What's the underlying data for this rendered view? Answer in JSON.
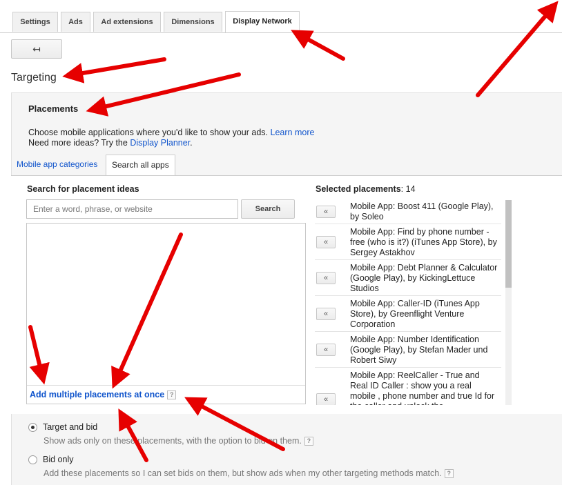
{
  "tabs": [
    {
      "label": "Settings"
    },
    {
      "label": "Ads"
    },
    {
      "label": "Ad extensions"
    },
    {
      "label": "Dimensions"
    },
    {
      "label": "Display Network",
      "active": true
    }
  ],
  "back_button": {
    "icon": "back-arrow-icon",
    "glyph": "↤"
  },
  "page_title": "Targeting",
  "placements": {
    "title": "Placements",
    "desc_line1": "Choose mobile applications where you'd like to show your ads.",
    "learn_more": "Learn more",
    "desc_line2_prefix": "Need more ideas? Try the",
    "display_planner": "Display Planner",
    "desc_line2_suffix": "."
  },
  "subtabs": {
    "categories": "Mobile app categories",
    "search_all": "Search all apps"
  },
  "search": {
    "label": "Search for placement ideas",
    "placeholder": "Enter a word, phrase, or website",
    "button": "Search",
    "add_multiple": "Add multiple placements at once",
    "help": "?"
  },
  "selected": {
    "label": "Selected placements",
    "count": "14",
    "remove_glyph": "«",
    "items": [
      "Mobile App: Boost 411 (Google Play), by Soleo",
      "Mobile App: Find by phone number - free (who is it?) (iTunes App Store), by Sergey Astakhov",
      "Mobile App: Debt Planner & Calculator (Google Play), by KickingLettuce Studios",
      "Mobile App: Caller-ID (iTunes App Store), by Greenflight Venture Corporation",
      "Mobile App: Number Identification (Google Play), by Stefan Mader und Robert Siwy",
      "Mobile App: ReelCaller - True and Real ID Caller : show you a real mobile , phone number and true Id for the caller and unlock the"
    ]
  },
  "options": {
    "target_and_bid": {
      "label": "Target and bid",
      "desc": "Show ads only on these placements, with the option to bid on them.",
      "checked": true
    },
    "bid_only": {
      "label": "Bid only",
      "desc": "Add these placements so I can set bids on them, but show ads when my other targeting methods match.",
      "checked": false
    }
  },
  "colors": {
    "link": "#1155cc",
    "arrow": "#e60000"
  }
}
